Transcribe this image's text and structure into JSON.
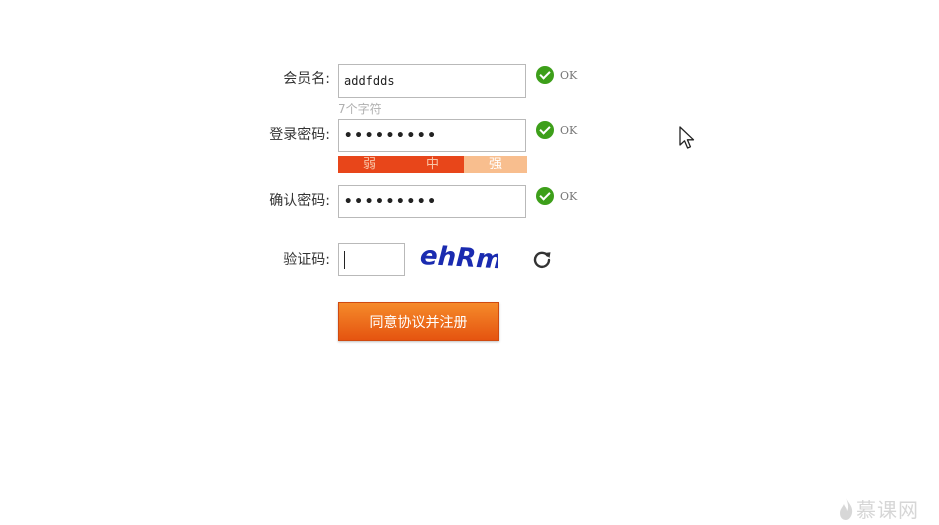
{
  "form": {
    "username": {
      "label": "会员名:",
      "value": "addfdds",
      "hint": "7个字符",
      "status": "OK"
    },
    "password": {
      "label": "登录密码:",
      "value": "•••••••••",
      "status": "OK",
      "strength": {
        "levels": [
          "弱",
          "中",
          "强"
        ],
        "current": "中"
      }
    },
    "confirm": {
      "label": "确认密码:",
      "value": "•••••••••",
      "status": "OK"
    },
    "captcha": {
      "label": "验证码:",
      "value": "",
      "image_text": "ehRm"
    },
    "submit_label": "同意协议并注册"
  },
  "watermark": {
    "text": "慕课网"
  },
  "colors": {
    "ok_green": "#3d9f1a",
    "strength_active": "#e8461a",
    "strength_inactive": "#f8be8e",
    "button": "#e55410",
    "captcha_text": "#1a2bb0"
  }
}
